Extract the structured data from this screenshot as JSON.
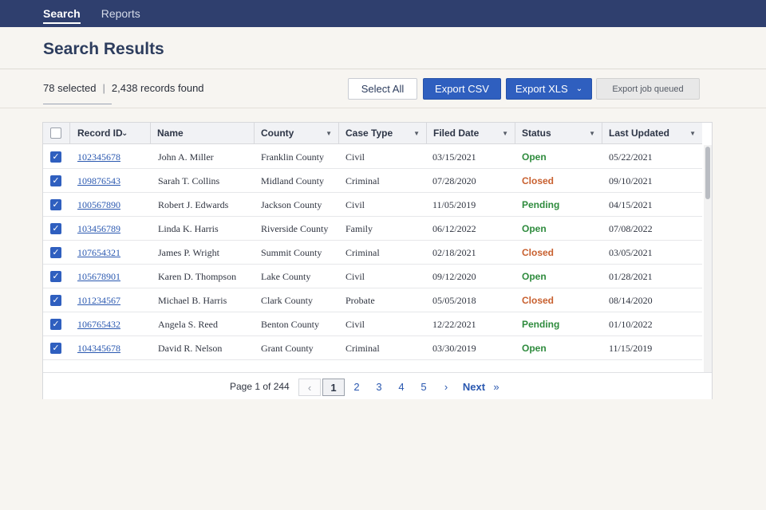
{
  "nav": {
    "tabs": [
      {
        "label": "Search"
      },
      {
        "label": "Reports"
      }
    ]
  },
  "page": {
    "title": "Search Results"
  },
  "summary": {
    "selected": "78 selected",
    "separator": "|",
    "found": "2,438 records found"
  },
  "toolbar": {
    "select_all": "Select All",
    "export_csv": "Export CSV",
    "export_xls": "Export XLS",
    "export_status": "Export job queued"
  },
  "table": {
    "columns": [
      "Record ID",
      "Name",
      "County",
      "Case Type",
      "Filed Date",
      "Status",
      "Last Updated"
    ],
    "rows": [
      {
        "id": "102345678",
        "name": "John A. Miller",
        "county": "Franklin County",
        "case_type": "Civil",
        "filed": "03/15/2021",
        "status": "Open",
        "updated": "05/22/2021"
      },
      {
        "id": "109876543",
        "name": "Sarah T. Collins",
        "county": "Midland County",
        "case_type": "Criminal",
        "filed": "07/28/2020",
        "status": "Closed",
        "updated": "09/10/2021"
      },
      {
        "id": "100567890",
        "name": "Robert J. Edwards",
        "county": "Jackson County",
        "case_type": "Civil",
        "filed": "11/05/2019",
        "status": "Pending",
        "updated": "04/15/2021"
      },
      {
        "id": "103456789",
        "name": "Linda K. Harris",
        "county": "Riverside County",
        "case_type": "Family",
        "filed": "06/12/2022",
        "status": "Open",
        "updated": "07/08/2022"
      },
      {
        "id": "107654321",
        "name": "James P. Wright",
        "county": "Summit County",
        "case_type": "Criminal",
        "filed": "02/18/2021",
        "status": "Closed",
        "updated": "03/05/2021"
      },
      {
        "id": "105678901",
        "name": "Karen D. Thompson",
        "county": "Lake County",
        "case_type": "Civil",
        "filed": "09/12/2020",
        "status": "Open",
        "updated": "01/28/2021"
      },
      {
        "id": "101234567",
        "name": "Michael B. Harris",
        "county": "Clark County",
        "case_type": "Probate",
        "filed": "05/05/2018",
        "status": "Closed",
        "updated": "08/14/2020"
      },
      {
        "id": "106765432",
        "name": "Angela S. Reed",
        "county": "Benton County",
        "case_type": "Civil",
        "filed": "12/22/2021",
        "status": "Pending",
        "updated": "01/10/2022"
      },
      {
        "id": "104345678",
        "name": "David R. Nelson",
        "county": "Grant County",
        "case_type": "Criminal",
        "filed": "03/30/2019",
        "status": "Open",
        "updated": "11/15/2019"
      }
    ]
  },
  "status_colors": {
    "Open": "#2e8b3d",
    "Closed": "#c8602f",
    "Pending": "#2e8b3d"
  },
  "pagination": {
    "info": "Page 1 of 244",
    "prev_icon": "chevron-left-icon",
    "pages": [
      "1",
      "2",
      "3",
      "4",
      "5"
    ],
    "next_icon": "chevron-right-icon",
    "next_label": "Next",
    "last_icon": "double-chevron-right-icon"
  }
}
